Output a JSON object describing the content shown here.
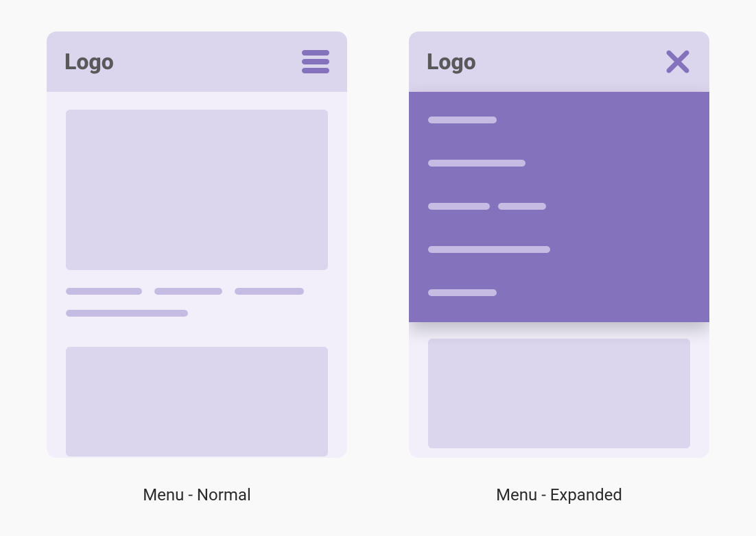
{
  "colors": {
    "background": "#f9f9fa",
    "phone_bg": "#f2effa",
    "header_bg": "#dcd5ee",
    "block_bg": "#dcd5ee",
    "text_line": "#c6bce3",
    "accent": "#8473bc",
    "menu_line": "#c6bce3",
    "logo_text": "#595959",
    "caption_text": "#2b2a2a"
  },
  "left": {
    "logo": "Logo",
    "caption": "Menu - Normal"
  },
  "right": {
    "logo": "Logo",
    "caption": "Menu - Expanded"
  }
}
